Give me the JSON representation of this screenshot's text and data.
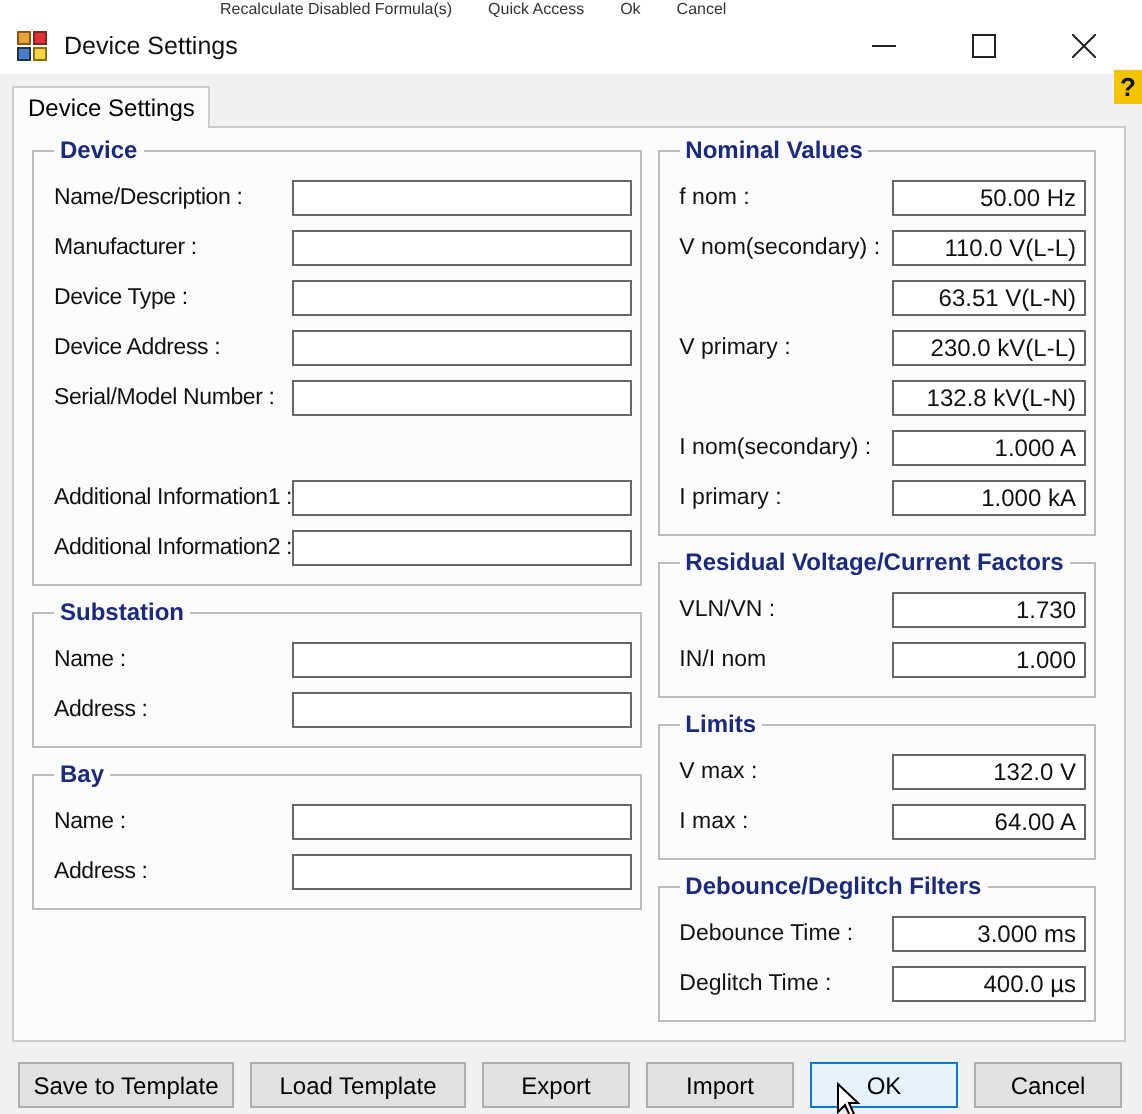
{
  "background_toolbar": [
    "Recalculate Disabled Formula(s)",
    "Quick Access",
    "Ok",
    "Cancel"
  ],
  "window": {
    "title": "Device Settings"
  },
  "help_badge": "?",
  "tabs": [
    {
      "label": "Device Settings",
      "selected": true
    }
  ],
  "left_groups": [
    {
      "title": "Device",
      "sections": [
        [
          {
            "label": "Name/Description :"
          },
          {
            "label": "Manufacturer :"
          },
          {
            "label": "Device Type :"
          },
          {
            "label": "Device Address :"
          },
          {
            "label": "Serial/Model Number :"
          }
        ],
        [
          {
            "label": "Additional Information1 :"
          },
          {
            "label": "Additional Information2 :"
          }
        ]
      ]
    },
    {
      "title": "Substation",
      "sections": [
        [
          {
            "label": "Name :"
          },
          {
            "label": "Address :"
          }
        ]
      ]
    },
    {
      "title": "Bay",
      "sections": [
        [
          {
            "label": "Name :"
          },
          {
            "label": "Address :"
          }
        ]
      ]
    }
  ],
  "right_groups": [
    {
      "title": "Nominal Values",
      "rows": [
        {
          "label": "f nom :",
          "value": "50.00 Hz"
        },
        {
          "label": "V nom(secondary) :",
          "value": "110.0 V(L-L)"
        },
        {
          "value": "63.51 V(L-N)"
        },
        {
          "label": "V primary :",
          "value": "230.0 kV(L-L)"
        },
        {
          "value": "132.8 kV(L-N)"
        },
        {
          "label": "I nom(secondary) :",
          "value": "1.000 A"
        },
        {
          "label": "I primary :",
          "value": "1.000 kA"
        }
      ]
    },
    {
      "title": "Residual Voltage/Current Factors",
      "rows": [
        {
          "label": "VLN/VN :",
          "value": "1.730"
        },
        {
          "label": "IN/I nom",
          "value": "1.000"
        }
      ]
    },
    {
      "title": "Limits",
      "rows": [
        {
          "label": "V max :",
          "value": "132.0 V"
        },
        {
          "label": "I max :",
          "value": "64.00 A"
        }
      ]
    },
    {
      "title": "Debounce/Deglitch Filters",
      "rows": [
        {
          "label": "Debounce Time :",
          "value": "3.000 ms"
        },
        {
          "label": "Deglitch Time :",
          "value": "400.0 µs"
        }
      ]
    }
  ],
  "buttons": [
    {
      "label": "Save to Template",
      "focused": false
    },
    {
      "label": "Load Template",
      "focused": false
    },
    {
      "label": "Export",
      "focused": false
    },
    {
      "label": "Import",
      "focused": false
    },
    {
      "label": "OK",
      "focused": true
    },
    {
      "label": "Cancel",
      "focused": false
    }
  ]
}
